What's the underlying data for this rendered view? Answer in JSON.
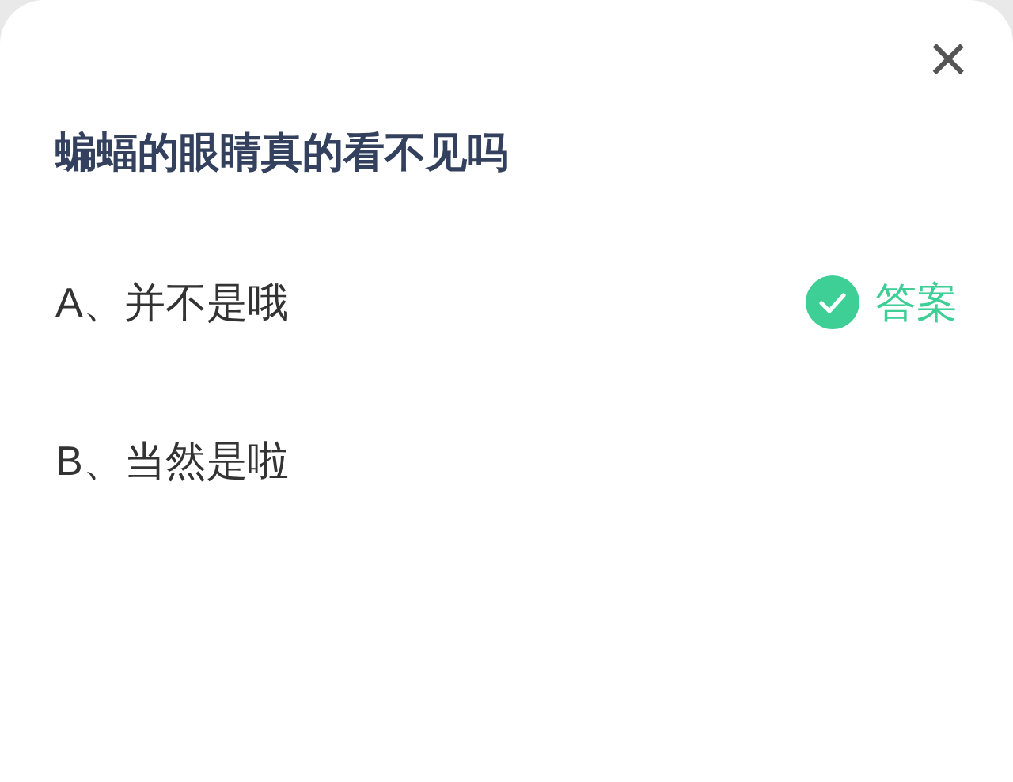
{
  "close_button": {
    "label": "×"
  },
  "question": "蝙蝠的眼睛真的看不见吗",
  "options": [
    {
      "label": "A、并不是哦",
      "correct": true,
      "answer_label": "答案"
    },
    {
      "label": "B、当然是啦",
      "correct": false
    }
  ]
}
